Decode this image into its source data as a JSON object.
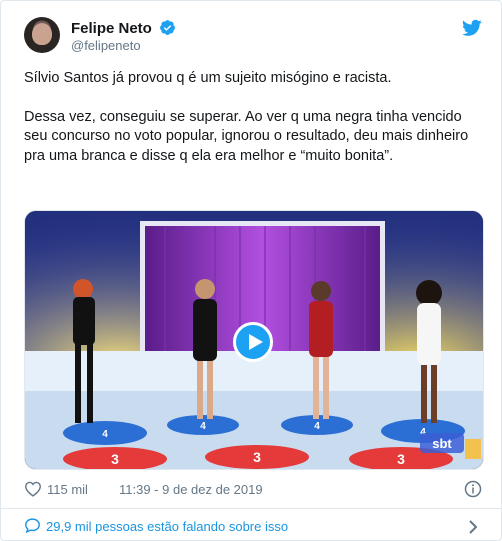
{
  "author": {
    "name": "Felipe Neto",
    "handle": "@felipeneto",
    "verified": true,
    "avatar_icon": "profile-photo"
  },
  "tweet": {
    "paragraphs": [
      "Sílvio Santos já provou q é um sujeito misógino e racista.",
      "Dessa vez, conseguiu se superar. Ao ver q uma negra tinha vencido seu concurso no voto popular, ignorou o resultado, deu mais dinheiro pra uma branca e disse q ela era melhor e “muito bonita”."
    ]
  },
  "media": {
    "type": "video",
    "play_icon": "play-icon",
    "podium_numbers": [
      "3",
      "3",
      "3",
      "4",
      "4",
      "4",
      "4"
    ],
    "watermark": "sbt"
  },
  "meta": {
    "likes": "115 mil",
    "datetime": "11:39 - 9 de dez de 2019"
  },
  "footer": {
    "conversation": "29,9 mil pessoas estão falando sobre isso"
  },
  "colors": {
    "twitter_blue": "#1da1f2",
    "link_blue": "#1b95e0",
    "text": "#14171a",
    "muted": "#657786",
    "border": "#e1e8ed"
  }
}
